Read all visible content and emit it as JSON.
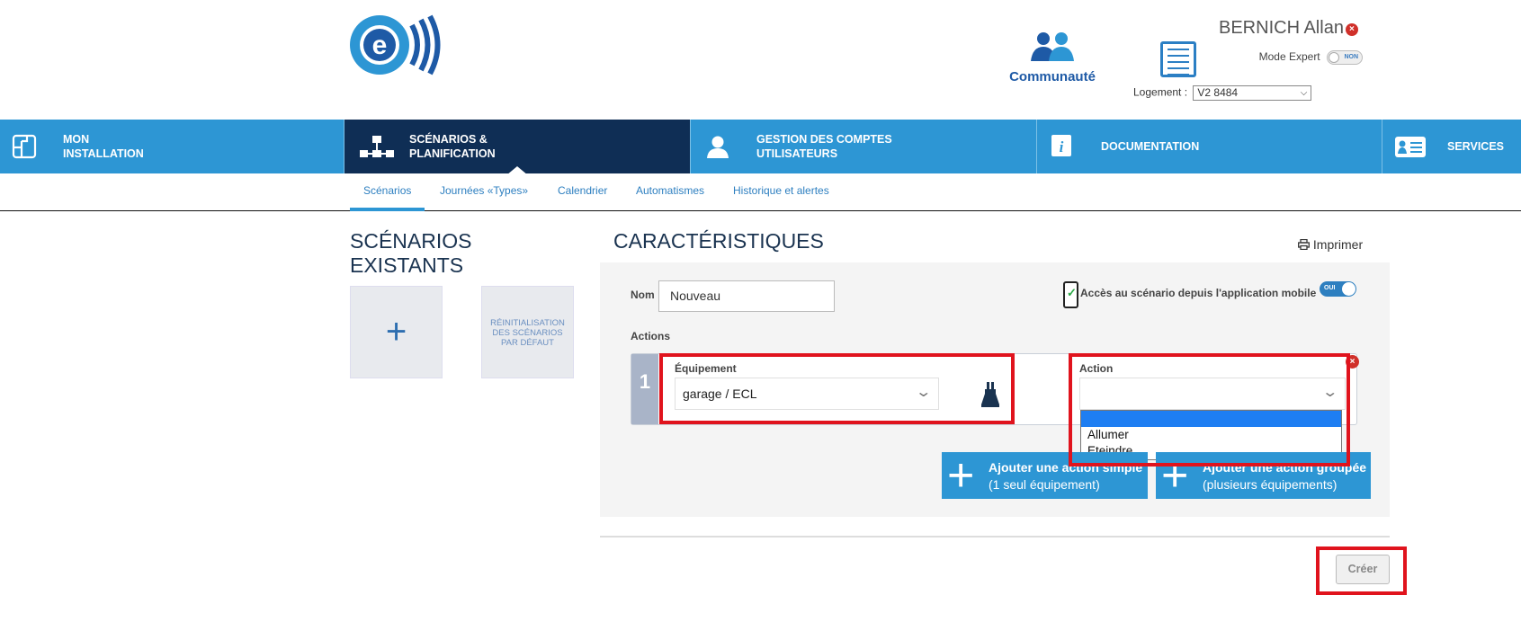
{
  "header": {
    "community_label": "Communauté",
    "user_name": "BERNICH Allan",
    "mode_expert_label": "Mode Expert",
    "mode_expert_state": "NON",
    "logement_label": "Logement :",
    "logement_value": "V2 8484"
  },
  "nav": {
    "items": [
      {
        "line1": "MON",
        "line2": "INSTALLATION"
      },
      {
        "line1": "SCÉNARIOS &",
        "line2": "PLANIFICATION"
      },
      {
        "line1": "GESTION DES COMPTES",
        "line2": "UTILISATEURS"
      },
      {
        "line1": "DOCUMENTATION"
      },
      {
        "line1": "SERVICES"
      }
    ]
  },
  "subnav": {
    "items": [
      "Scénarios",
      "Journées «Types»",
      "Calendrier",
      "Automatismes",
      "Historique et alertes"
    ]
  },
  "left": {
    "title_line1": "SCÉNARIOS",
    "title_line2": "EXISTANTS",
    "add_tile": "+",
    "reset_tile": [
      "RÉINITIALISATION",
      "DES SCÉNARIOS",
      "PAR DÉFAUT"
    ]
  },
  "main": {
    "title": "CARACTÉRISTIQUES",
    "print_label": "Imprimer",
    "nom_label": "Nom",
    "nom_value": "Nouveau",
    "mobile_access_label": "Accès au scénario depuis l'application mobile",
    "mobile_access_state": "OUI",
    "actions_label": "Actions",
    "action_row": {
      "number": "1",
      "equipment_label": "Équipement",
      "equipment_value": "garage / ECL",
      "action_label": "Action",
      "action_value": "",
      "action_options": [
        "",
        "Allumer",
        "Eteindre"
      ]
    },
    "add_simple": {
      "line1": "Ajouter une action simple",
      "line2": "(1 seul équipement)"
    },
    "add_group": {
      "line1": "Ajouter une action groupée",
      "line2": "(plusieurs équipements)"
    },
    "create_label": "Créer"
  },
  "colors": {
    "nav_bg": "#2d96d4",
    "nav_active": "#0f2e55",
    "highlight": "#e0131d",
    "dropdown_selected": "#1e7ef2"
  }
}
